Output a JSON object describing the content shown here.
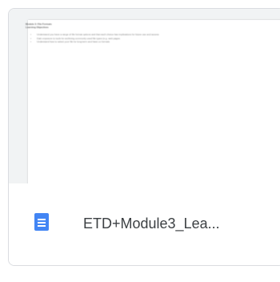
{
  "file": {
    "name": "ETD+Module3_Lea...",
    "type_icon": "google-docs-icon",
    "icon_color": "#4285f4"
  },
  "preview": {
    "heading_line1": "Module 3: File Formats",
    "heading_line2": "Learning Objectives",
    "bullets": [
      "Understand you have a range of file format options and that each choice has implications for future use and access",
      "Gain exposure to tools for archiving commonly used file types (e.g. web pages",
      "Understand how to select your file for long-term and have ox formats"
    ]
  }
}
